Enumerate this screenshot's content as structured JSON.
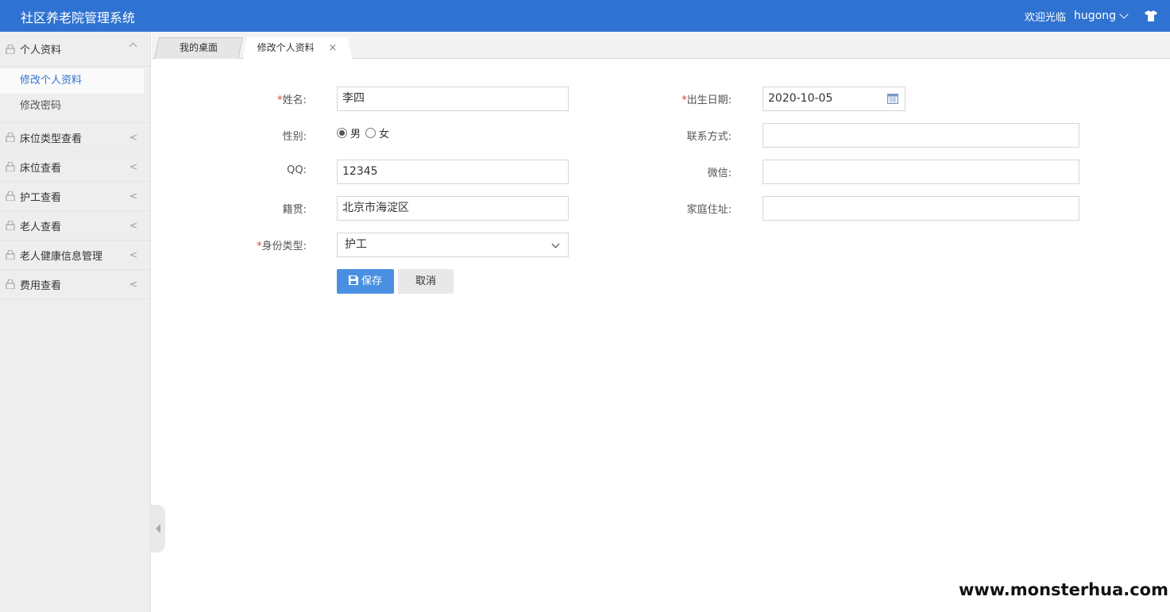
{
  "header": {
    "title": "社区养老院管理系统",
    "welcome": "欢迎光临",
    "username": "hugong",
    "theme_icon": "shirt-icon"
  },
  "sidebar": {
    "groups": [
      {
        "label": "个人资料",
        "expanded": true,
        "items": [
          "修改个人资料",
          "修改密码"
        ]
      },
      {
        "label": "床位类型查看",
        "arrow": "<"
      },
      {
        "label": "床位查看",
        "arrow": "<"
      },
      {
        "label": "护工查看",
        "arrow": "<"
      },
      {
        "label": "老人查看",
        "arrow": "<"
      },
      {
        "label": "老人健康信息管理",
        "arrow": "<"
      },
      {
        "label": "费用查看",
        "arrow": "<"
      }
    ],
    "active_item": "修改个人资料"
  },
  "tabs": [
    {
      "label": "我的桌面"
    },
    {
      "label": "修改个人资料",
      "close": "×"
    }
  ],
  "form": {
    "required_mark": "*",
    "name": {
      "label": "姓名:",
      "value": "李四"
    },
    "gender": {
      "label": "性别:",
      "options": [
        "男",
        "女"
      ],
      "selected": "男"
    },
    "qq": {
      "label": "QQ:",
      "value": "12345"
    },
    "hometown": {
      "label": "籍贯:",
      "value": "北京市海淀区"
    },
    "identity": {
      "label": "身份类型:",
      "value": "护工"
    },
    "birthday": {
      "label": "出生日期:",
      "value": "2020-10-05"
    },
    "contact": {
      "label": "联系方式:",
      "value": ""
    },
    "wechat": {
      "label": "微信:",
      "value": ""
    },
    "address": {
      "label": "家庭住址:",
      "value": ""
    },
    "save_label": "保存",
    "cancel_label": "取消"
  },
  "colors": {
    "header_bg": "#2f72d1",
    "accent": "#4a90e2",
    "required": "#e4393c"
  },
  "watermark": "www.monsterhua.com"
}
